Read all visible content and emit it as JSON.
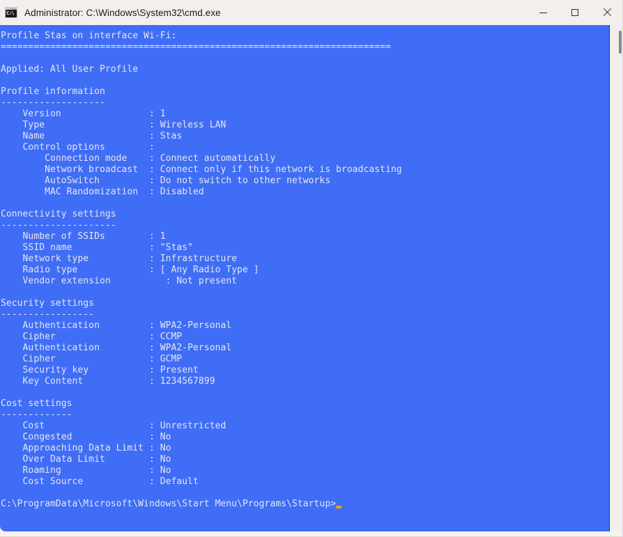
{
  "window": {
    "title": "Administrator: C:\\Windows\\System32\\cmd.exe",
    "icon_name": "cmd-icon",
    "icon_prompt_text": "C:\\",
    "colors": {
      "terminal_background": "#3f6df5",
      "terminal_foreground": "#e6e6f2",
      "titlebar_background": "#f3efed",
      "titlebar_foreground": "#1a1a1a",
      "cursor": "#e8a317",
      "scrollbar_thumb": "#8a8a8a"
    },
    "controls": {
      "minimize_label": "Minimize",
      "maximize_label": "Maximize",
      "close_label": "Close"
    }
  },
  "terminal": {
    "lines": [
      "Profile Stas on interface Wi-Fi:",
      "=======================================================================",
      "",
      "Applied: All User Profile",
      "",
      "Profile information",
      "-------------------",
      "    Version                : 1",
      "    Type                   : Wireless LAN",
      "    Name                   : Stas",
      "    Control options        :",
      "        Connection mode    : Connect automatically",
      "        Network broadcast  : Connect only if this network is broadcasting",
      "        AutoSwitch         : Do not switch to other networks",
      "        MAC Randomization  : Disabled",
      "",
      "Connectivity settings",
      "---------------------",
      "    Number of SSIDs        : 1",
      "    SSID name              : \"Stas\"",
      "    Network type           : Infrastructure",
      "    Radio type             : [ Any Radio Type ]",
      "    Vendor extension          : Not present",
      "",
      "Security settings",
      "-----------------",
      "    Authentication         : WPA2-Personal",
      "    Cipher                 : CCMP",
      "    Authentication         : WPA2-Personal",
      "    Cipher                 : GCMP",
      "    Security key           : Present",
      "    Key Content            : 1234567899",
      "",
      "Cost settings",
      "-------------",
      "    Cost                   : Unrestricted",
      "    Congested              : No",
      "    Approaching Data Limit : No",
      "    Over Data Limit        : No",
      "    Roaming                : No",
      "    Cost Source            : Default",
      ""
    ],
    "prompt": "C:\\ProgramData\\Microsoft\\Windows\\Start Menu\\Programs\\Startup>"
  }
}
